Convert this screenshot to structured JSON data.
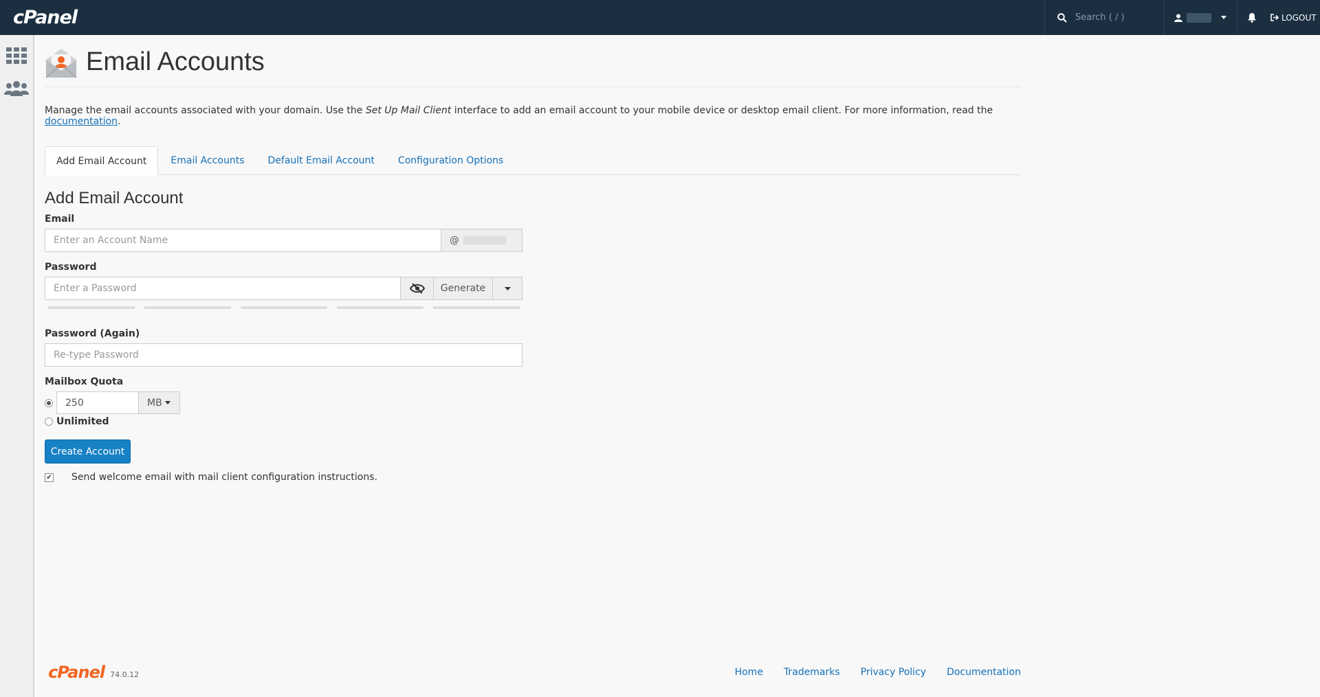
{
  "topbar": {
    "brand": "cPanel",
    "search_placeholder": "Search ( / )",
    "logout_label": "LOGOUT"
  },
  "sidebar": {
    "items": [
      {
        "icon": "grid-icon"
      },
      {
        "icon": "users-icon"
      }
    ]
  },
  "page": {
    "title": "Email Accounts",
    "intro_before": "Manage the email accounts associated with your domain. Use the ",
    "intro_italic": "Set Up Mail Client",
    "intro_middle": " interface to add an email account to your mobile device or desktop email client. For more information, read the ",
    "intro_link": "documentation",
    "intro_end": "."
  },
  "tabs": [
    {
      "label": "Add Email Account",
      "active": true
    },
    {
      "label": "Email Accounts",
      "active": false
    },
    {
      "label": "Default Email Account",
      "active": false
    },
    {
      "label": "Configuration Options",
      "active": false
    }
  ],
  "form": {
    "section_title": "Add Email Account",
    "email_label": "Email",
    "email_placeholder": "Enter an Account Name",
    "domain_prefix": "@",
    "password_label": "Password",
    "password_placeholder": "Enter a Password",
    "generate_label": "Generate",
    "password_again_label": "Password (Again)",
    "password_again_placeholder": "Re-type Password",
    "quota_label": "Mailbox Quota",
    "quota_value": "250",
    "quota_unit": "MB",
    "unlimited_label": "Unlimited",
    "create_button": "Create Account",
    "welcome_email_label": "Send welcome email with mail client configuration instructions.",
    "welcome_email_checked": true
  },
  "footer": {
    "brand": "cPanel",
    "version": "74.0.12",
    "links": [
      "Home",
      "Trademarks",
      "Privacy Policy",
      "Documentation"
    ]
  },
  "colors": {
    "topbar": "#1b2f41",
    "link": "#1570b8",
    "primary_button": "#1681c4",
    "brand_orange": "#f26522"
  }
}
